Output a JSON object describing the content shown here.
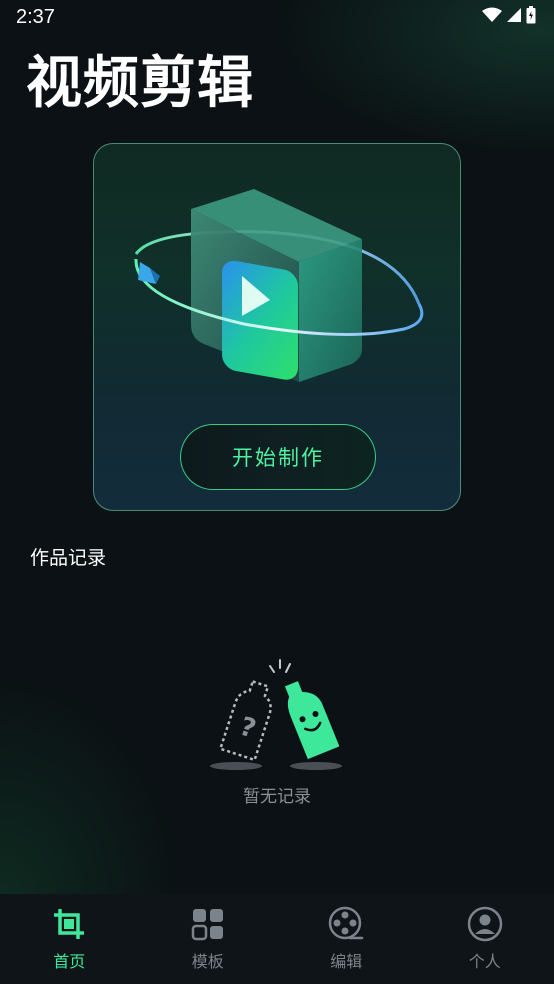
{
  "status_bar": {
    "time": "2:37"
  },
  "app": {
    "title": "视频剪辑"
  },
  "hero": {
    "start_button_label": "开始制作"
  },
  "records": {
    "section_title": "作品记录",
    "empty_text": "暂无记录"
  },
  "bottom_nav": {
    "items": [
      {
        "label": "首页",
        "icon": "crop-icon",
        "active": true
      },
      {
        "label": "模板",
        "icon": "grid-icon",
        "active": false
      },
      {
        "label": "编辑",
        "icon": "film-reel-icon",
        "active": false
      },
      {
        "label": "个人",
        "icon": "person-icon",
        "active": false
      }
    ]
  },
  "colors": {
    "accent": "#3ee89a",
    "background": "#0b1114",
    "nav_inactive": "#7d838a"
  }
}
